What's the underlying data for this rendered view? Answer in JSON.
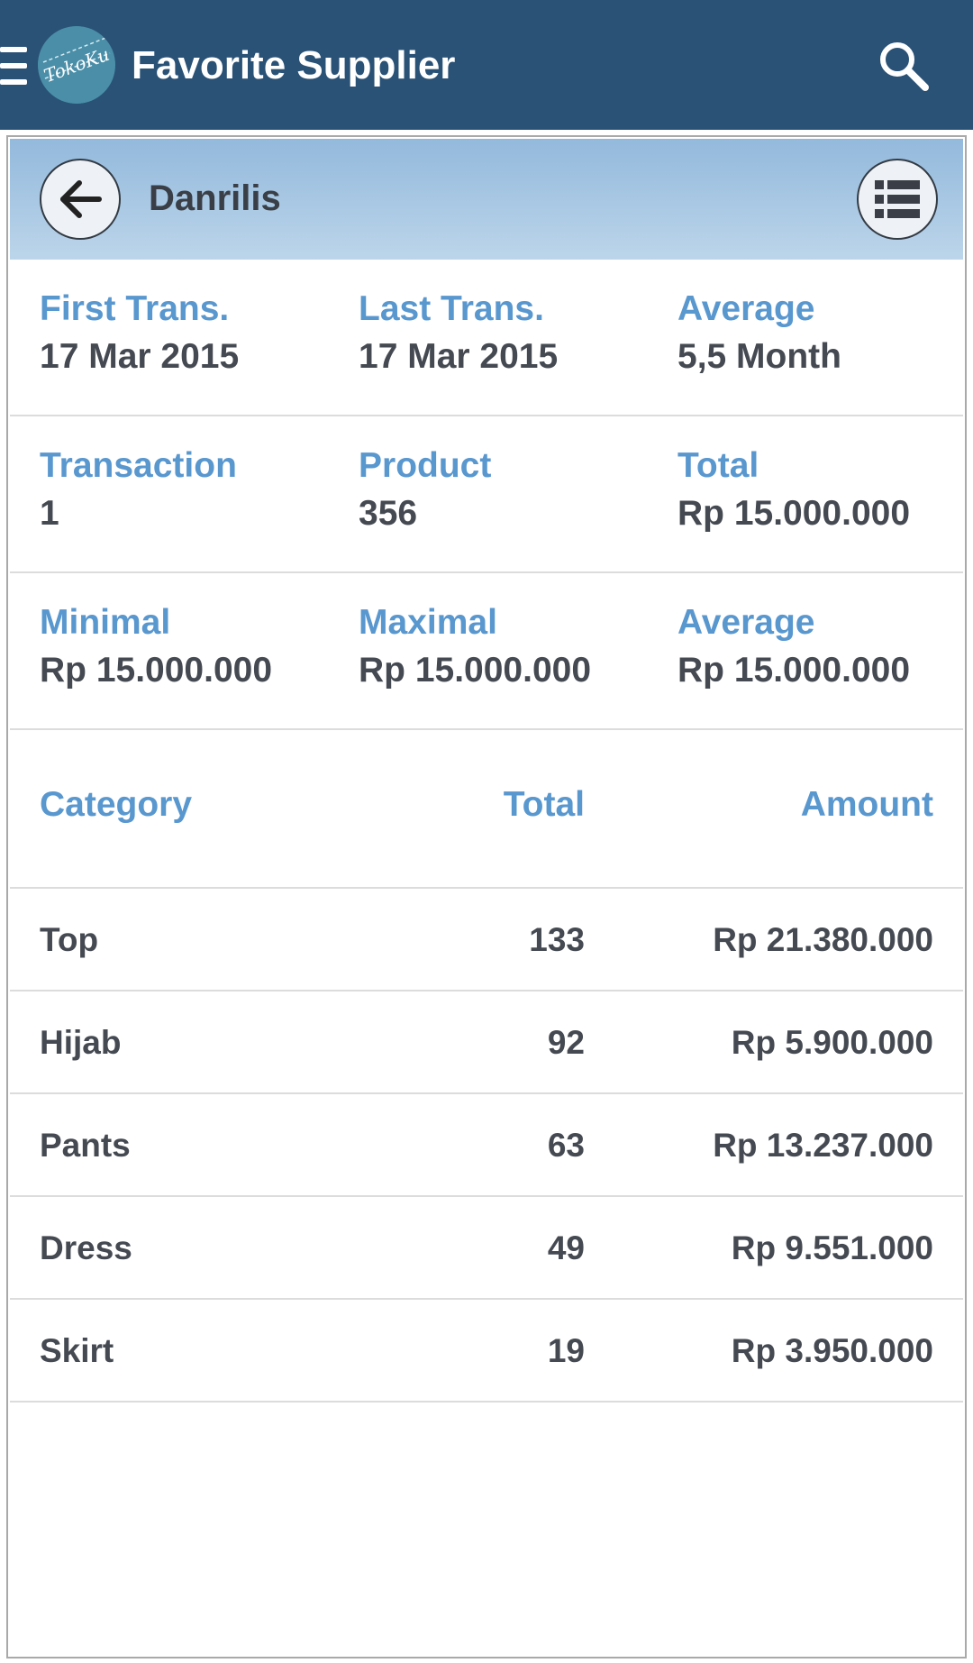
{
  "appbar": {
    "title": "Favorite Supplier",
    "logo_text": "TokoKu",
    "menu_icon": "hamburger-menu-icon",
    "search_icon": "search-icon",
    "background_color": "#2a5276"
  },
  "supplier": {
    "name": "Danrilis",
    "back_icon": "arrow-left-icon",
    "list_icon": "list-view-icon"
  },
  "stats": [
    [
      {
        "label": "First Trans.",
        "value": "17 Mar 2015"
      },
      {
        "label": "Last Trans.",
        "value": "17 Mar 2015"
      },
      {
        "label": "Average",
        "value": "5,5 Month"
      }
    ],
    [
      {
        "label": "Transaction",
        "value": "1"
      },
      {
        "label": "Product",
        "value": "356"
      },
      {
        "label": "Total",
        "value": "Rp 15.000.000"
      }
    ],
    [
      {
        "label": "Minimal",
        "value": "Rp 15.000.000"
      },
      {
        "label": "Maximal",
        "value": "Rp 15.000.000"
      },
      {
        "label": "Average",
        "value": "Rp 15.000.000"
      }
    ]
  ],
  "category_table": {
    "headers": {
      "category": "Category",
      "total": "Total",
      "amount": "Amount"
    },
    "rows": [
      {
        "category": "Top",
        "total": "133",
        "amount": "Rp 21.380.000"
      },
      {
        "category": "Hijab",
        "total": "92",
        "amount": "Rp 5.900.000"
      },
      {
        "category": "Pants",
        "total": "63",
        "amount": "Rp 13.237.000"
      },
      {
        "category": "Dress",
        "total": "49",
        "amount": "Rp 9.551.000"
      },
      {
        "category": "Skirt",
        "total": "19",
        "amount": "Rp 3.950.000"
      }
    ]
  },
  "colors": {
    "label_blue": "#5997cf",
    "value_dark": "#454a52",
    "header_gradient_top": "#93b9dc",
    "header_gradient_bottom": "#bcd5ea"
  }
}
